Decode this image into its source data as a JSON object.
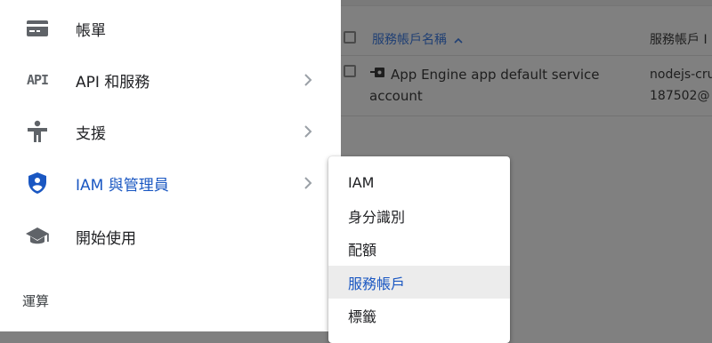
{
  "nav": {
    "items": [
      {
        "label": "帳單",
        "icon": "billing-card-icon"
      },
      {
        "label": "API 和服務",
        "icon": "api-icon",
        "icon_text": "API"
      },
      {
        "label": "支援",
        "icon": "support-person-icon"
      },
      {
        "label": "IAM 與管理員",
        "icon": "shield-person-icon"
      },
      {
        "label": "開始使用",
        "icon": "graduation-cap-icon"
      }
    ],
    "section_label": "運算"
  },
  "submenu": {
    "items": [
      "IAM",
      "身分識別",
      "配額",
      "服務帳戶",
      "標籤"
    ],
    "selected": "服務帳戶"
  },
  "table": {
    "col_name": "服務帳戶名稱",
    "col_id": "服務帳戶 I",
    "row": {
      "name_line1": "App Engine app default service",
      "name_line2": "account",
      "id_line1": "nodejs-cru",
      "id_line2": "187502@"
    }
  },
  "colors": {
    "accent": "#1a57c2",
    "selected_bg": "#ececec",
    "overlay": "#808080"
  }
}
